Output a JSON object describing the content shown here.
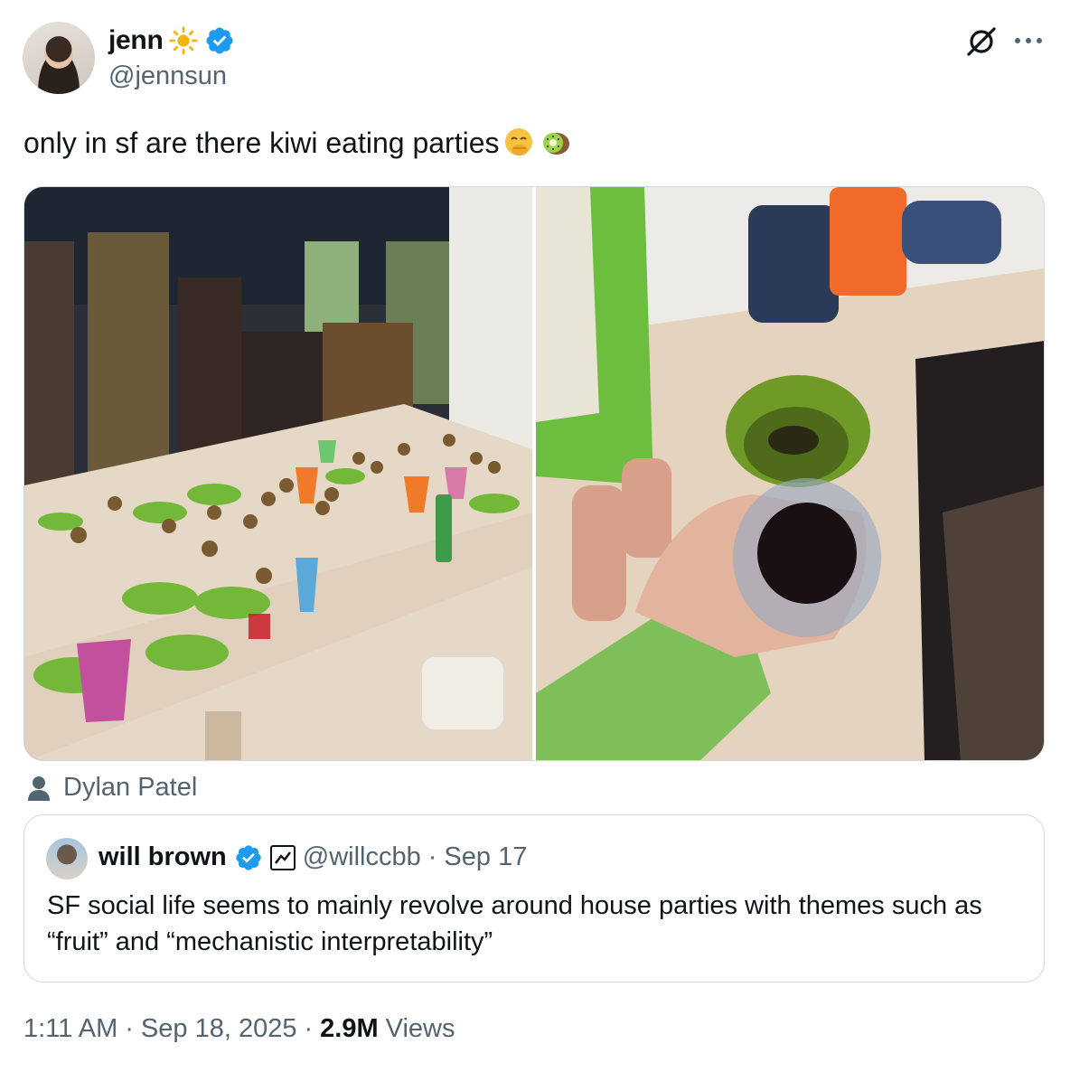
{
  "author": {
    "display_name": "jenn",
    "handle": "@jennsun",
    "name_emoji": "sun-icon",
    "verified": true,
    "verified_color": "#1d9bf0"
  },
  "actions": {
    "grok_icon": "grok-icon",
    "more_icon": "more-icon"
  },
  "tweet": {
    "text": "only in sf are there kiwi eating parties",
    "emojis": [
      "face-with-hand-over-mouth-icon",
      "kiwi-icon"
    ]
  },
  "media": {
    "photo_count": 2,
    "tagged_person": "Dylan Patel"
  },
  "quote": {
    "display_name": "will brown",
    "handle": "@willccbb",
    "date": "Sep 17",
    "separator": "·",
    "verified": true,
    "text": "SF social life seems to mainly revolve around house parties with themes such as “fruit” and “mechanistic interpretability”"
  },
  "footer": {
    "time": "1:11 AM",
    "date": "Sep 18, 2025",
    "separator": "·",
    "views_count": "2.9M",
    "views_label": "Views"
  },
  "colors": {
    "text_primary": "#0f1419",
    "text_secondary": "#536471",
    "border": "#cfd9de",
    "accent": "#1d9bf0"
  }
}
